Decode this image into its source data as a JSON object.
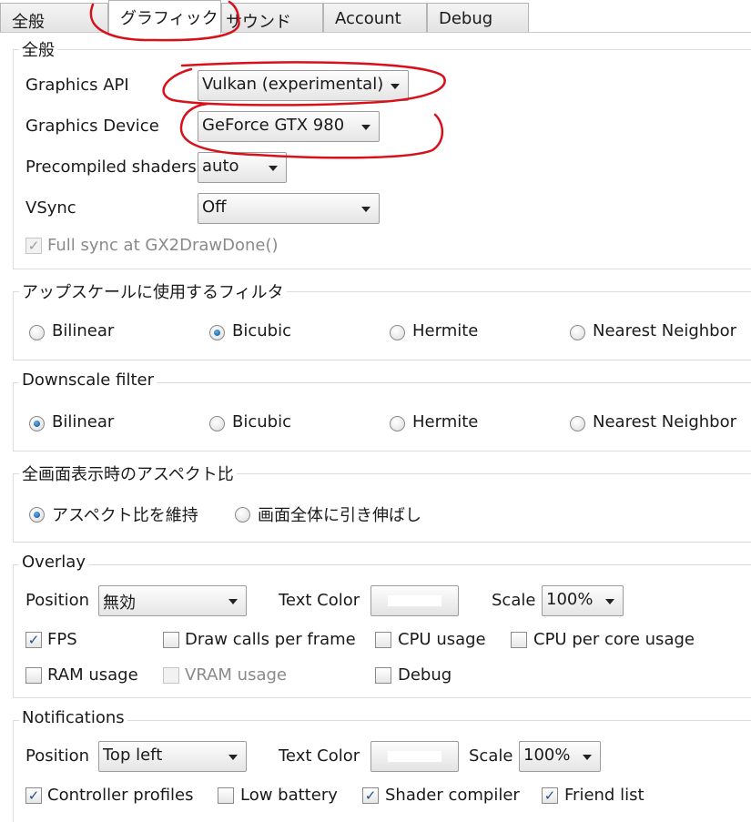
{
  "tabs": [
    {
      "label": "全般"
    },
    {
      "label": "グラフィック"
    },
    {
      "label": "サウンド"
    },
    {
      "label": "Account"
    },
    {
      "label": "Debug"
    }
  ],
  "general": {
    "title": "全般",
    "api_label": "Graphics API",
    "api_value": "Vulkan (experimental)",
    "device_label": "Graphics Device",
    "device_value": "GeForce GTX 980",
    "shaders_label": "Precompiled shaders",
    "shaders_value": "auto",
    "vsync_label": "VSync",
    "vsync_value": "Off",
    "fullsync_label": "Full sync at GX2DrawDone()",
    "fullsync_checked": true
  },
  "upscale": {
    "title": "アップスケールに使用するフィルタ",
    "options": [
      "Bilinear",
      "Bicubic",
      "Hermite",
      "Nearest Neighbor"
    ],
    "selected": "Bicubic"
  },
  "downscale": {
    "title": "Downscale filter",
    "options": [
      "Bilinear",
      "Bicubic",
      "Hermite",
      "Nearest Neighbor"
    ],
    "selected": "Bilinear"
  },
  "aspect": {
    "title": "全画面表示時のアスペクト比",
    "options": [
      "アスペクト比を維持",
      "画面全体に引き伸ばし"
    ],
    "selected": "アスペクト比を維持"
  },
  "overlay": {
    "title": "Overlay",
    "position_label": "Position",
    "position_value": "無効",
    "textcolor_label": "Text Color",
    "scale_label": "Scale",
    "scale_value": "100%",
    "checks": [
      {
        "label": "FPS",
        "checked": true,
        "enabled": true
      },
      {
        "label": "Draw calls per frame",
        "checked": false,
        "enabled": true
      },
      {
        "label": "CPU usage",
        "checked": false,
        "enabled": true
      },
      {
        "label": "CPU per core usage",
        "checked": false,
        "enabled": true
      },
      {
        "label": "RAM usage",
        "checked": false,
        "enabled": true
      },
      {
        "label": "VRAM usage",
        "checked": false,
        "enabled": false
      },
      {
        "label": "Debug",
        "checked": false,
        "enabled": true
      }
    ]
  },
  "notifications": {
    "title": "Notifications",
    "position_label": "Position",
    "position_value": "Top left",
    "textcolor_label": "Text Color",
    "scale_label": "Scale",
    "scale_value": "100%",
    "checks": [
      {
        "label": "Controller profiles",
        "checked": true,
        "enabled": true
      },
      {
        "label": "Low battery",
        "checked": false,
        "enabled": true
      },
      {
        "label": "Shader compiler",
        "checked": true,
        "enabled": true
      },
      {
        "label": "Friend list",
        "checked": true,
        "enabled": true
      }
    ]
  },
  "colors": {
    "annotation": "#d8101a",
    "radio_selected": "#0a4b8a",
    "check_mark": "#1f4e8c"
  }
}
